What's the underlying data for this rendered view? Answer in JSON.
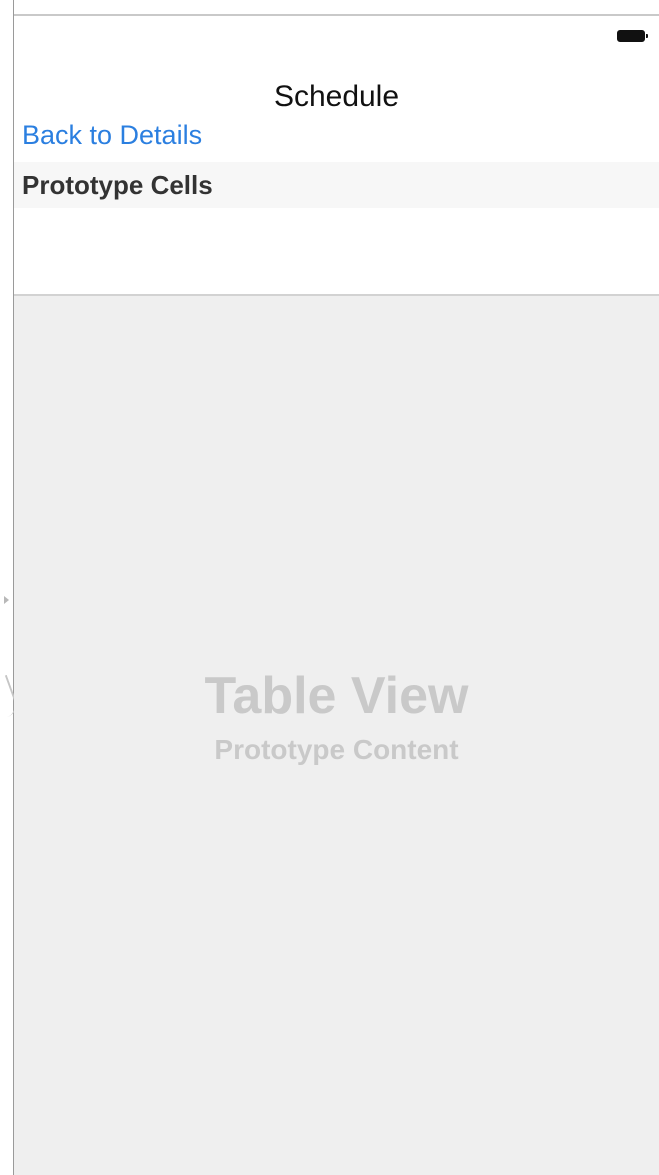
{
  "status_bar": {
    "battery_icon": "battery-full-icon"
  },
  "nav_bar": {
    "title": "Schedule",
    "back_label": "Back to Details"
  },
  "table": {
    "section_header": "Prototype Cells",
    "placeholder_title": "Table View",
    "placeholder_subtitle": "Prototype Content"
  },
  "colors": {
    "tint": "#2b7fe0",
    "table_background": "#efefef",
    "placeholder_text": "#c9c9c9"
  }
}
